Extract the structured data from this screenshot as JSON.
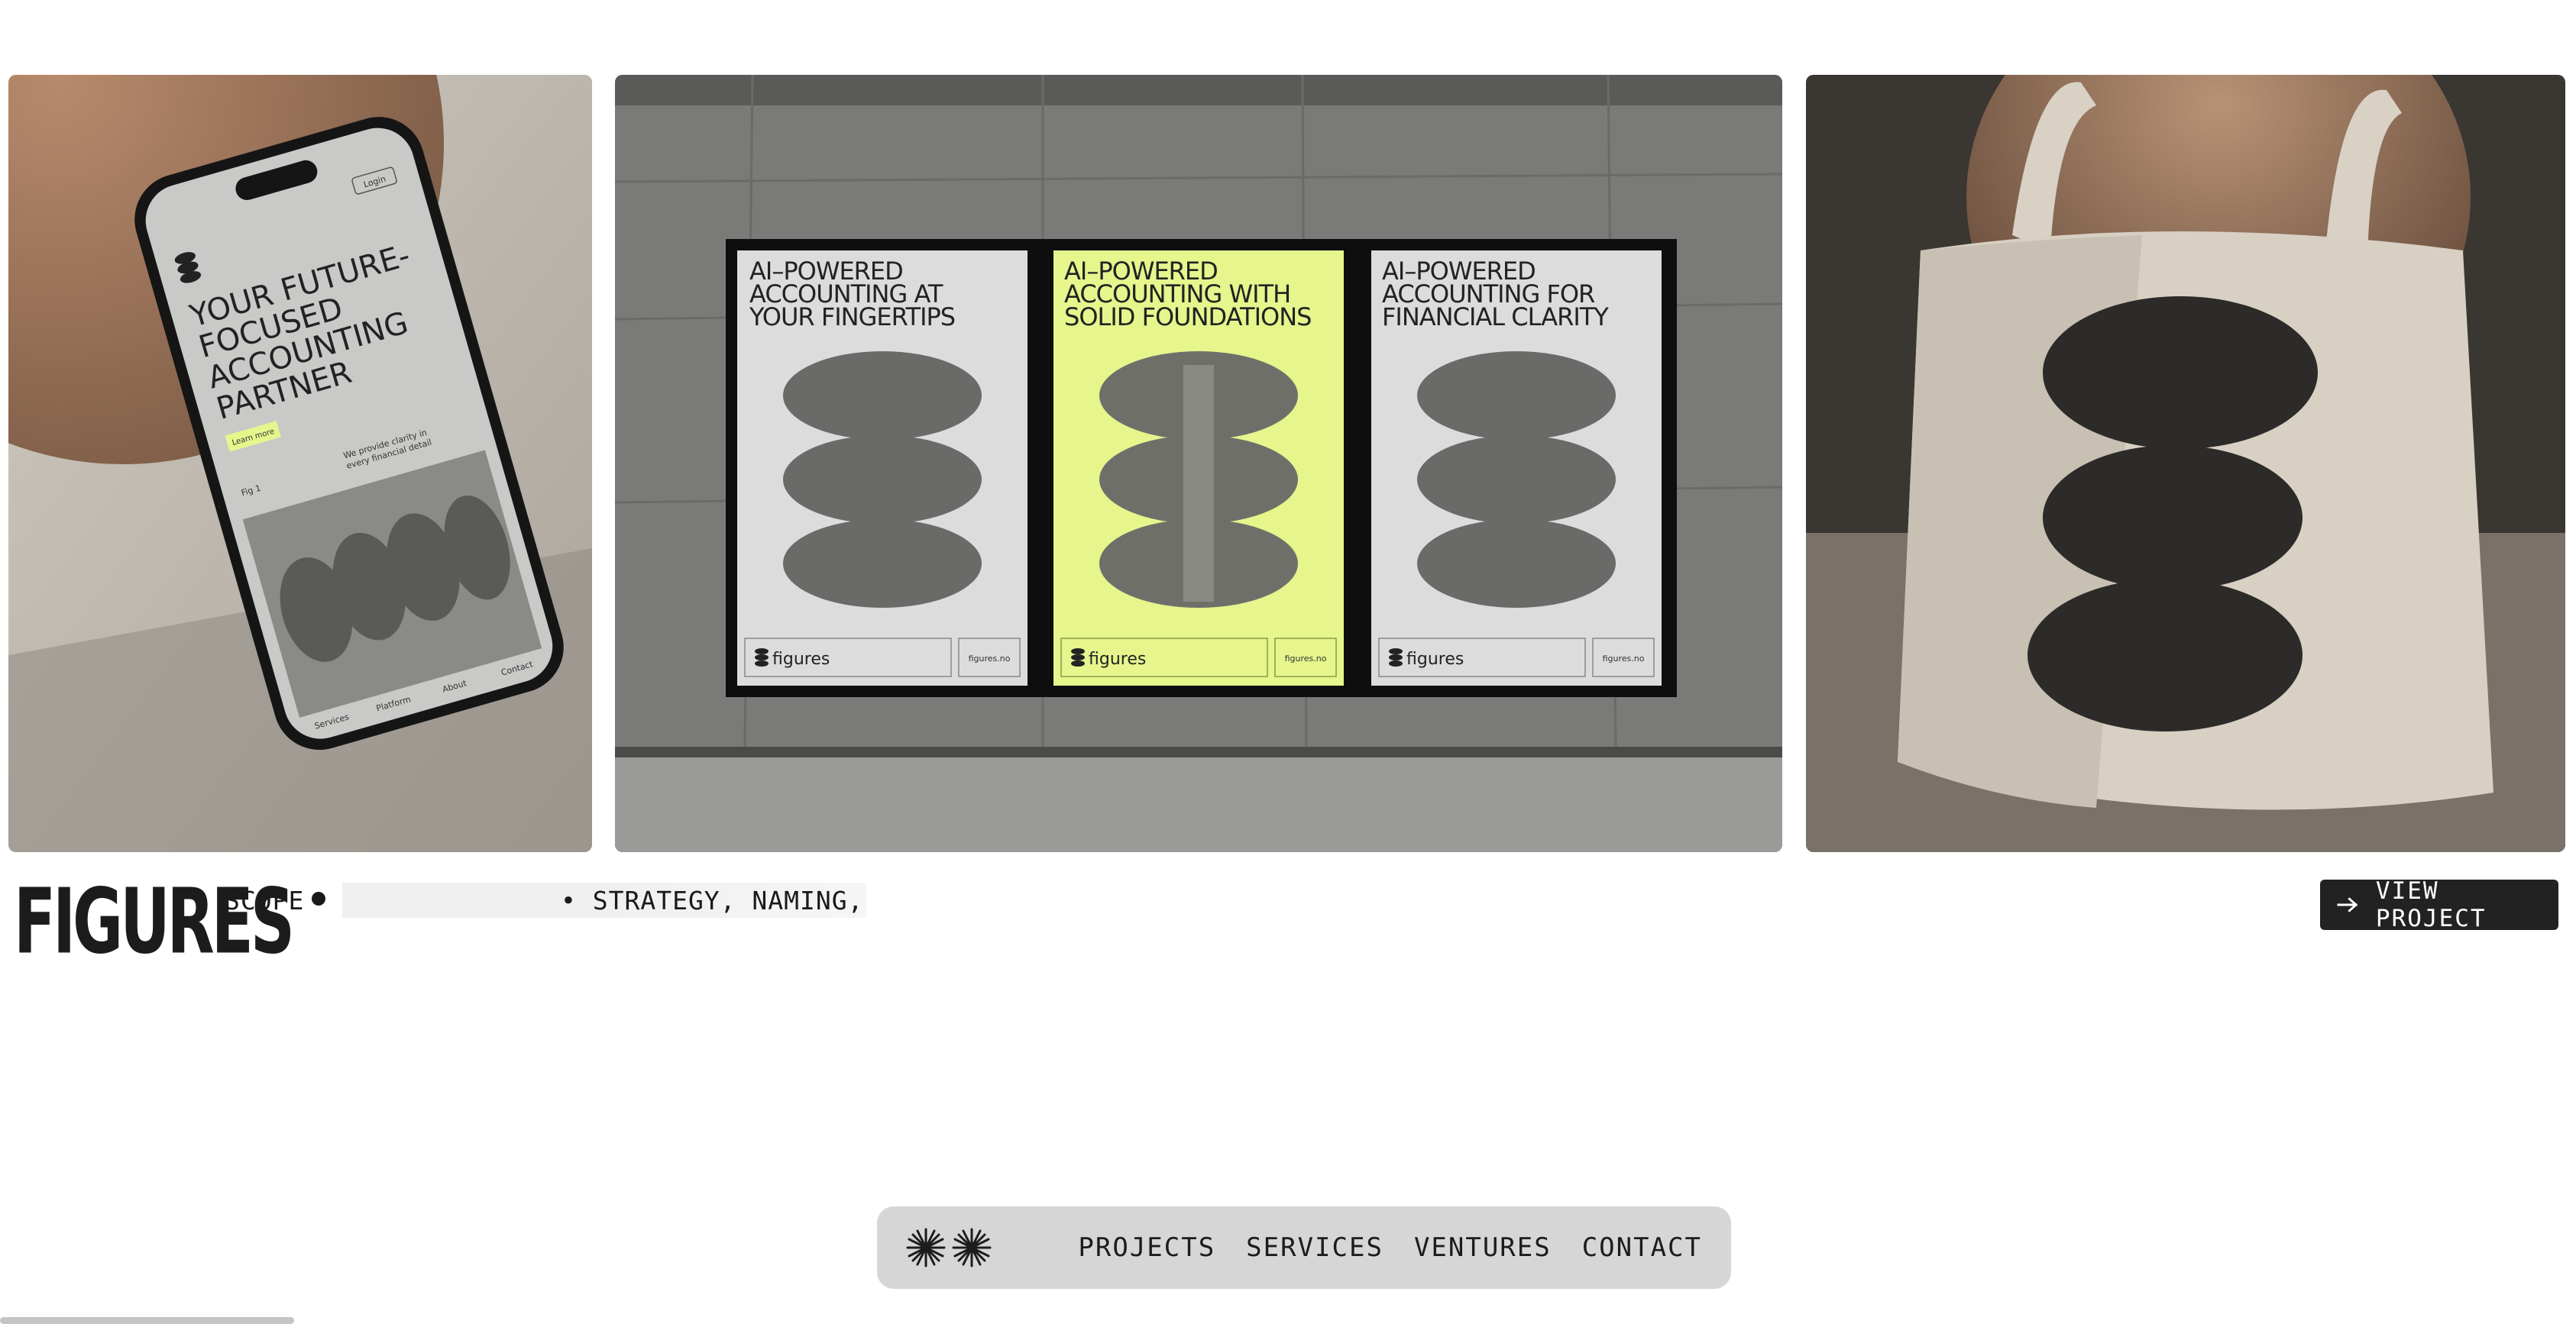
{
  "gallery": {
    "phone": {
      "login": "Login",
      "headline": [
        "YOUR FUTURE-",
        "FOCUSED",
        "ACCOUNTING",
        "PARTNER"
      ],
      "cta": "Learn more",
      "fig": "Fig 1",
      "blurb": [
        "We provide clarity in",
        "every financial detail"
      ],
      "nav": [
        "Services",
        "Platform",
        "About",
        "Contact"
      ]
    },
    "posters": [
      {
        "headline": [
          "AI–POWERED",
          "ACCOUNTING AT",
          "YOUR FINGERTIPS"
        ],
        "brand": "figures",
        "url": "figures.no",
        "bg": "#dcdcdc"
      },
      {
        "headline": [
          "AI–POWERED",
          "ACCOUNTING WITH",
          "SOLID FOUNDATIONS"
        ],
        "brand": "figures",
        "url": "figures.no",
        "bg": "#e6f58c"
      },
      {
        "headline": [
          "AI–POWERED",
          "ACCOUNTING FOR",
          "FINANCIAL CLARITY"
        ],
        "brand": "figures",
        "url": "figures.no",
        "bg": "#dcdcdc"
      }
    ]
  },
  "project": {
    "logo": "FIGURES",
    "scope_label": "SCOPE",
    "scope_ticker": "• STRATEGY, NAMING, B",
    "view_button": "VIEW PROJECT",
    "arrow_icon": "arrow-right-icon"
  },
  "nav": {
    "logo_icon": "starburst-icon",
    "links": [
      "PROJECTS",
      "SERVICES",
      "VENTURES",
      "CONTACT"
    ]
  },
  "colors": {
    "accent": "#e6f58c",
    "button_bg": "#222222",
    "nav_bg": "#d6d6d6"
  }
}
